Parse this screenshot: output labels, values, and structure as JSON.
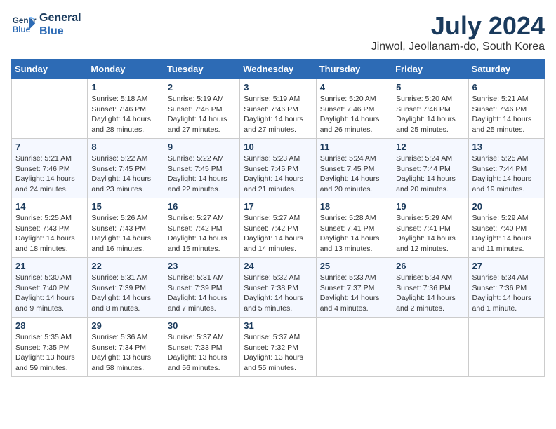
{
  "header": {
    "logo_line1": "General",
    "logo_line2": "Blue",
    "month_title": "July 2024",
    "location": "Jinwol, Jeollanam-do, South Korea"
  },
  "columns": [
    "Sunday",
    "Monday",
    "Tuesday",
    "Wednesday",
    "Thursday",
    "Friday",
    "Saturday"
  ],
  "weeks": [
    [
      {
        "day": "",
        "content": ""
      },
      {
        "day": "1",
        "content": "Sunrise: 5:18 AM\nSunset: 7:46 PM\nDaylight: 14 hours\nand 28 minutes."
      },
      {
        "day": "2",
        "content": "Sunrise: 5:19 AM\nSunset: 7:46 PM\nDaylight: 14 hours\nand 27 minutes."
      },
      {
        "day": "3",
        "content": "Sunrise: 5:19 AM\nSunset: 7:46 PM\nDaylight: 14 hours\nand 27 minutes."
      },
      {
        "day": "4",
        "content": "Sunrise: 5:20 AM\nSunset: 7:46 PM\nDaylight: 14 hours\nand 26 minutes."
      },
      {
        "day": "5",
        "content": "Sunrise: 5:20 AM\nSunset: 7:46 PM\nDaylight: 14 hours\nand 25 minutes."
      },
      {
        "day": "6",
        "content": "Sunrise: 5:21 AM\nSunset: 7:46 PM\nDaylight: 14 hours\nand 25 minutes."
      }
    ],
    [
      {
        "day": "7",
        "content": "Sunrise: 5:21 AM\nSunset: 7:46 PM\nDaylight: 14 hours\nand 24 minutes."
      },
      {
        "day": "8",
        "content": "Sunrise: 5:22 AM\nSunset: 7:45 PM\nDaylight: 14 hours\nand 23 minutes."
      },
      {
        "day": "9",
        "content": "Sunrise: 5:22 AM\nSunset: 7:45 PM\nDaylight: 14 hours\nand 22 minutes."
      },
      {
        "day": "10",
        "content": "Sunrise: 5:23 AM\nSunset: 7:45 PM\nDaylight: 14 hours\nand 21 minutes."
      },
      {
        "day": "11",
        "content": "Sunrise: 5:24 AM\nSunset: 7:45 PM\nDaylight: 14 hours\nand 20 minutes."
      },
      {
        "day": "12",
        "content": "Sunrise: 5:24 AM\nSunset: 7:44 PM\nDaylight: 14 hours\nand 20 minutes."
      },
      {
        "day": "13",
        "content": "Sunrise: 5:25 AM\nSunset: 7:44 PM\nDaylight: 14 hours\nand 19 minutes."
      }
    ],
    [
      {
        "day": "14",
        "content": "Sunrise: 5:25 AM\nSunset: 7:43 PM\nDaylight: 14 hours\nand 18 minutes."
      },
      {
        "day": "15",
        "content": "Sunrise: 5:26 AM\nSunset: 7:43 PM\nDaylight: 14 hours\nand 16 minutes."
      },
      {
        "day": "16",
        "content": "Sunrise: 5:27 AM\nSunset: 7:42 PM\nDaylight: 14 hours\nand 15 minutes."
      },
      {
        "day": "17",
        "content": "Sunrise: 5:27 AM\nSunset: 7:42 PM\nDaylight: 14 hours\nand 14 minutes."
      },
      {
        "day": "18",
        "content": "Sunrise: 5:28 AM\nSunset: 7:41 PM\nDaylight: 14 hours\nand 13 minutes."
      },
      {
        "day": "19",
        "content": "Sunrise: 5:29 AM\nSunset: 7:41 PM\nDaylight: 14 hours\nand 12 minutes."
      },
      {
        "day": "20",
        "content": "Sunrise: 5:29 AM\nSunset: 7:40 PM\nDaylight: 14 hours\nand 11 minutes."
      }
    ],
    [
      {
        "day": "21",
        "content": "Sunrise: 5:30 AM\nSunset: 7:40 PM\nDaylight: 14 hours\nand 9 minutes."
      },
      {
        "day": "22",
        "content": "Sunrise: 5:31 AM\nSunset: 7:39 PM\nDaylight: 14 hours\nand 8 minutes."
      },
      {
        "day": "23",
        "content": "Sunrise: 5:31 AM\nSunset: 7:39 PM\nDaylight: 14 hours\nand 7 minutes."
      },
      {
        "day": "24",
        "content": "Sunrise: 5:32 AM\nSunset: 7:38 PM\nDaylight: 14 hours\nand 5 minutes."
      },
      {
        "day": "25",
        "content": "Sunrise: 5:33 AM\nSunset: 7:37 PM\nDaylight: 14 hours\nand 4 minutes."
      },
      {
        "day": "26",
        "content": "Sunrise: 5:34 AM\nSunset: 7:36 PM\nDaylight: 14 hours\nand 2 minutes."
      },
      {
        "day": "27",
        "content": "Sunrise: 5:34 AM\nSunset: 7:36 PM\nDaylight: 14 hours\nand 1 minute."
      }
    ],
    [
      {
        "day": "28",
        "content": "Sunrise: 5:35 AM\nSunset: 7:35 PM\nDaylight: 13 hours\nand 59 minutes."
      },
      {
        "day": "29",
        "content": "Sunrise: 5:36 AM\nSunset: 7:34 PM\nDaylight: 13 hours\nand 58 minutes."
      },
      {
        "day": "30",
        "content": "Sunrise: 5:37 AM\nSunset: 7:33 PM\nDaylight: 13 hours\nand 56 minutes."
      },
      {
        "day": "31",
        "content": "Sunrise: 5:37 AM\nSunset: 7:32 PM\nDaylight: 13 hours\nand 55 minutes."
      },
      {
        "day": "",
        "content": ""
      },
      {
        "day": "",
        "content": ""
      },
      {
        "day": "",
        "content": ""
      }
    ]
  ]
}
